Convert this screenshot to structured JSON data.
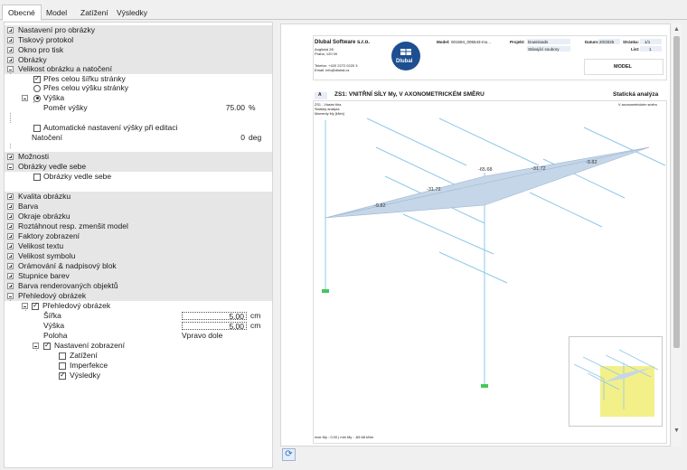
{
  "tabs": [
    "Obecné",
    "Model",
    "Zatížení",
    "Výsledky"
  ],
  "tree": {
    "sections_top": [
      "Nastavení pro obrázky",
      "Tiskový protokol",
      "Okno pro tisk",
      "Obrázky",
      "Velikost obrázku a natočení"
    ],
    "size_items": {
      "full_width": "Přes celou šířku stránky",
      "full_height": "Přes celou výšku stránky",
      "height": "Výška",
      "height_ratio": "Poměr výšky",
      "height_ratio_value": "75.00",
      "height_ratio_unit": "%",
      "auto_height": "Automatické nastavení výšky při editaci",
      "rotation": "Natočení",
      "rotation_value": "0",
      "rotation_unit": "deg"
    },
    "options": "Možnosti",
    "side_images": "Obrázky vedle sebe",
    "side_images_item": "Obrázky vedle sebe",
    "sections_mid": [
      "Kvalita obrázku",
      "Barva",
      "Okraje obrázku",
      "Roztáhnout resp. zmenšit model",
      "Faktory zobrazení",
      "Velikost textu",
      "Velikost symbolu",
      "Orámování & nadpisový blok",
      "Stupnice barev",
      "Barva renderovaných objektů",
      "Přehledový obrázek"
    ],
    "overview": {
      "item": "Přehledový obrázek",
      "width_label": "Šířka",
      "width_value": "5.00",
      "width_unit": "cm",
      "height_label": "Výška",
      "height_value": "5.00",
      "height_unit": "cm",
      "position_label": "Poloha",
      "position_value": "Vpravo dole",
      "display_settings": "Nastavení zobrazení",
      "loads": "Zatížení",
      "imperfections": "Imperfekce",
      "results": "Výsledky"
    }
  },
  "report": {
    "company": "Dlubal Software s.r.o.",
    "address1": "Anglická 28",
    "address2": "Praha, 120 00",
    "phone": "Telefon: +420 2272 0220 3",
    "email": "Email: info@dlubal.cz",
    "logo_text": "Dlubal",
    "model_label": "Model:",
    "model_value": "001594_005543-mo...",
    "project_label": "Projekt:",
    "project_value": "Downloads",
    "project_sub": "Stávající soubory",
    "date_label": "Datum:",
    "date_value": "20/2025",
    "page_label": "Stránka:",
    "page_value": "1/1",
    "list_label": "List:",
    "list_value": "1",
    "box_title": "MODEL",
    "section_letter": "A",
    "section_title": "ZS1: VNITŘNÍ SÍLY My, V AXONOMETRICKÉM SMĚRU",
    "section_right": "Statická analýza",
    "view_label1": "ZS1 - Vlastní tíha",
    "view_label2": "Statický analýza",
    "view_label3": "Momenty My [kNm]",
    "view_right": "V axonometrickém směru",
    "values": [
      "-9.82",
      "-31.72",
      "-65.68",
      "-31.72",
      "-9.82"
    ],
    "footer": "max My : 0.00 | min My : -65.68 kNm"
  }
}
